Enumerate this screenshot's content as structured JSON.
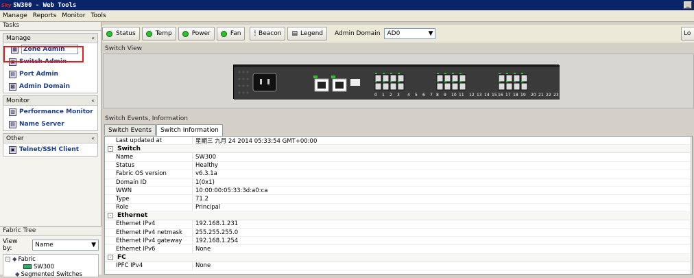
{
  "window": {
    "logo": "Sky",
    "title": "SW300 - Web Tools",
    "min_btn": "_"
  },
  "menu": [
    "Manage",
    "Reports",
    "Monitor",
    "Tools"
  ],
  "tasks": {
    "title": "Tasks",
    "manage": {
      "header": "Manage",
      "items": [
        "Zone Admin",
        "Switch Admin",
        "Port Admin",
        "Admin Domain"
      ]
    },
    "monitor": {
      "header": "Monitor",
      "items": [
        "Performance Monitor",
        "Name Server"
      ]
    },
    "other": {
      "header": "Other",
      "items": [
        "Telnet/SSH Client"
      ]
    }
  },
  "fabric_tree": {
    "title": "Fabric Tree",
    "view_by_label": "View by:",
    "view_by_value": "Name",
    "nodes": [
      "Fabric",
      "SW300",
      "Segmented Switches"
    ]
  },
  "toolbar": {
    "status": "Status",
    "temp": "Temp",
    "power": "Power",
    "fan": "Fan",
    "beacon": "Beacon",
    "legend": "Legend",
    "admin_domain_label": "Admin Domain",
    "admin_domain_value": "AD0",
    "logout": "Lo"
  },
  "switch_view": {
    "label": "Switch View",
    "port_labels": [
      "0",
      "1",
      "2",
      "3",
      "4",
      "5",
      "6",
      "7",
      "8",
      "9",
      "10",
      "11",
      "12",
      "13",
      "14",
      "15",
      "16",
      "17",
      "18",
      "19",
      "20",
      "21",
      "22",
      "23"
    ]
  },
  "events": {
    "label": "Switch Events, Information",
    "tabs": [
      "Switch Events",
      "Switch Information"
    ],
    "last_updated_label": "Last updated at",
    "last_updated_value": "星期三 九月 24 2014 05:33:54 GMT+00:00",
    "switch_header": "Switch",
    "switch_rows": [
      {
        "k": "Name",
        "v": "SW300"
      },
      {
        "k": "Status",
        "v": "Healthy"
      },
      {
        "k": "Fabric OS version",
        "v": "v6.3.1a"
      },
      {
        "k": "Domain ID",
        "v": "1(0x1)"
      },
      {
        "k": "WWN",
        "v": "10:00:00:05:33:3d:a0:ca"
      },
      {
        "k": "Type",
        "v": "71.2"
      },
      {
        "k": "Role",
        "v": "Principal"
      }
    ],
    "ethernet_header": "Ethernet",
    "ethernet_rows": [
      {
        "k": "Ethernet IPv4",
        "v": "192.168.1.231"
      },
      {
        "k": "Ethernet IPv4 netmask",
        "v": "255.255.255.0"
      },
      {
        "k": "Ethernet IPv4 gateway",
        "v": "192.168.1.254"
      },
      {
        "k": "Ethernet IPv6",
        "v": "None"
      }
    ],
    "fc_header": "FC",
    "fc_rows": [
      {
        "k": "IPFC IPv4",
        "v": "None"
      }
    ]
  },
  "colors": {
    "titlebar": "#0a246a",
    "status_green": "#2ec12e",
    "highlight_red": "#e02020"
  }
}
